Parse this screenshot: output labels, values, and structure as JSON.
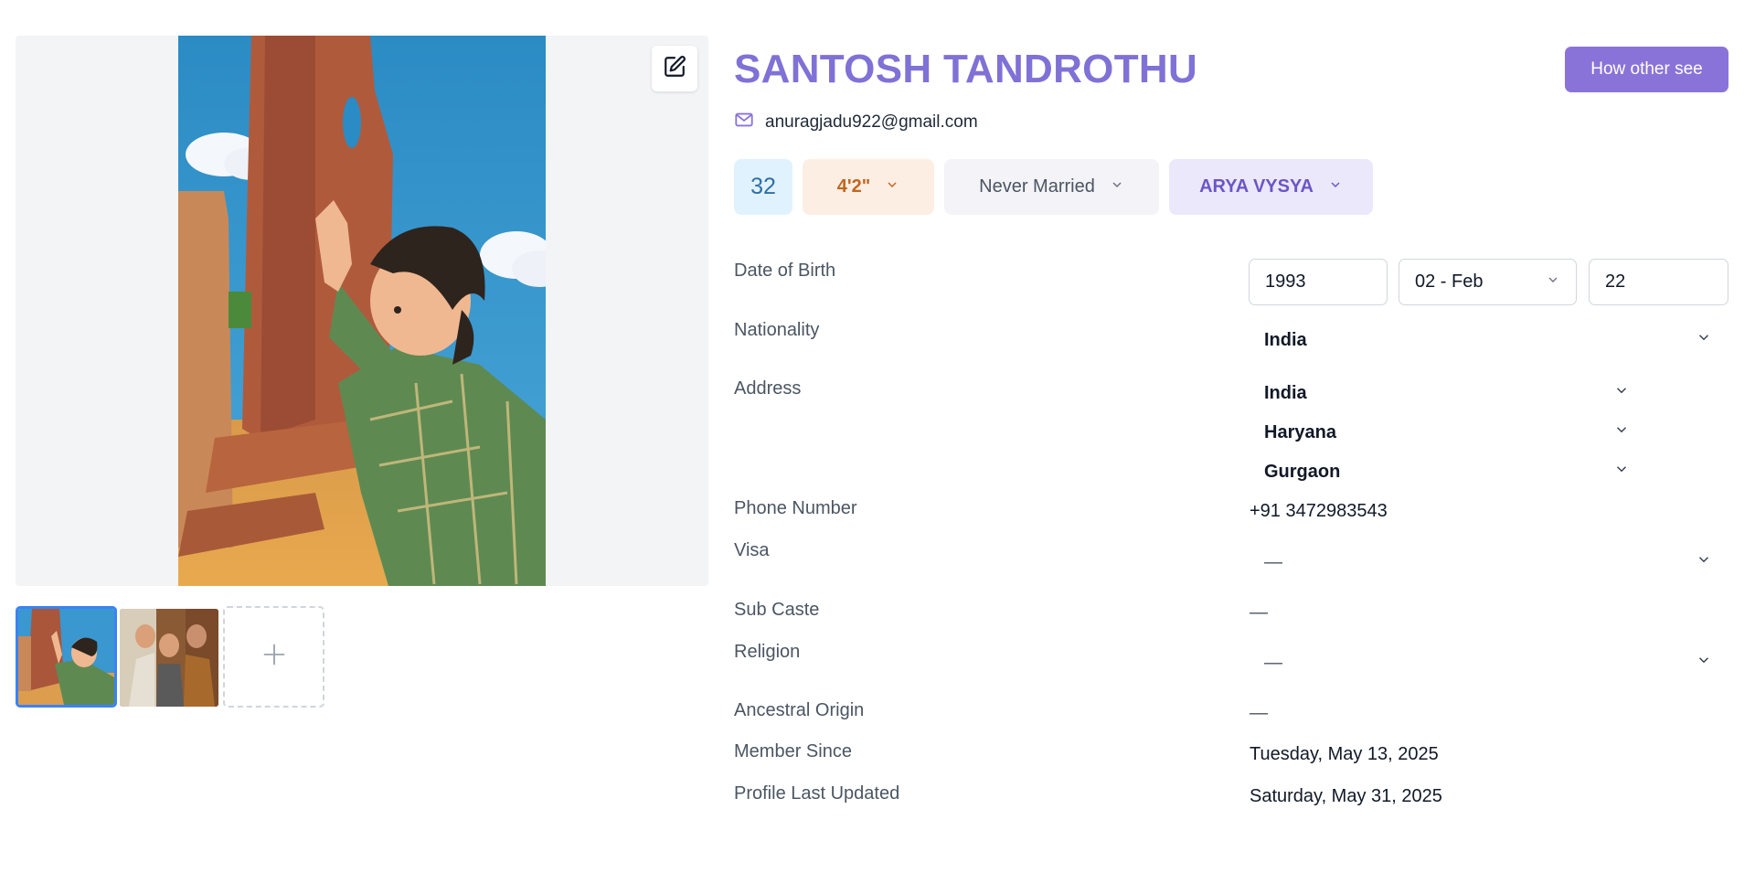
{
  "profile": {
    "name": "SANTOSH TANDROTHU",
    "email": "anuragjadu922@gmail.com",
    "how_other_see_label": "How other see"
  },
  "chips": {
    "age": "32",
    "height": "4'2\"",
    "marital_status": "Never Married",
    "caste": "ARYA VYSYA"
  },
  "fields": {
    "dob_label": "Date of Birth",
    "dob_year": "1993",
    "dob_month": "02 - Feb",
    "dob_day": "22",
    "nationality_label": "Nationality",
    "nationality_value": "India",
    "address_label": "Address",
    "address_country": "India",
    "address_state": "Haryana",
    "address_city": "Gurgaon",
    "phone_label": "Phone Number",
    "phone_value": "+91 3472983543",
    "visa_label": "Visa",
    "visa_value": "—",
    "subcaste_label": "Sub Caste",
    "subcaste_value": "—",
    "religion_label": "Religion",
    "religion_value": "—",
    "ancestral_label": "Ancestral Origin",
    "ancestral_value": "—",
    "member_since_label": "Member Since",
    "member_since_value": "Tuesday, May 13, 2025",
    "last_updated_label": "Profile Last Updated",
    "last_updated_value": "Saturday, May 31, 2025"
  },
  "icons": {
    "edit": "edit-icon",
    "mail": "mail-icon",
    "chevron": "chevron-down-icon",
    "plus": "plus-icon"
  },
  "colors": {
    "accent": "#8071d6",
    "button": "#8a73d8",
    "active_thumb_border": "#3b82f6"
  }
}
